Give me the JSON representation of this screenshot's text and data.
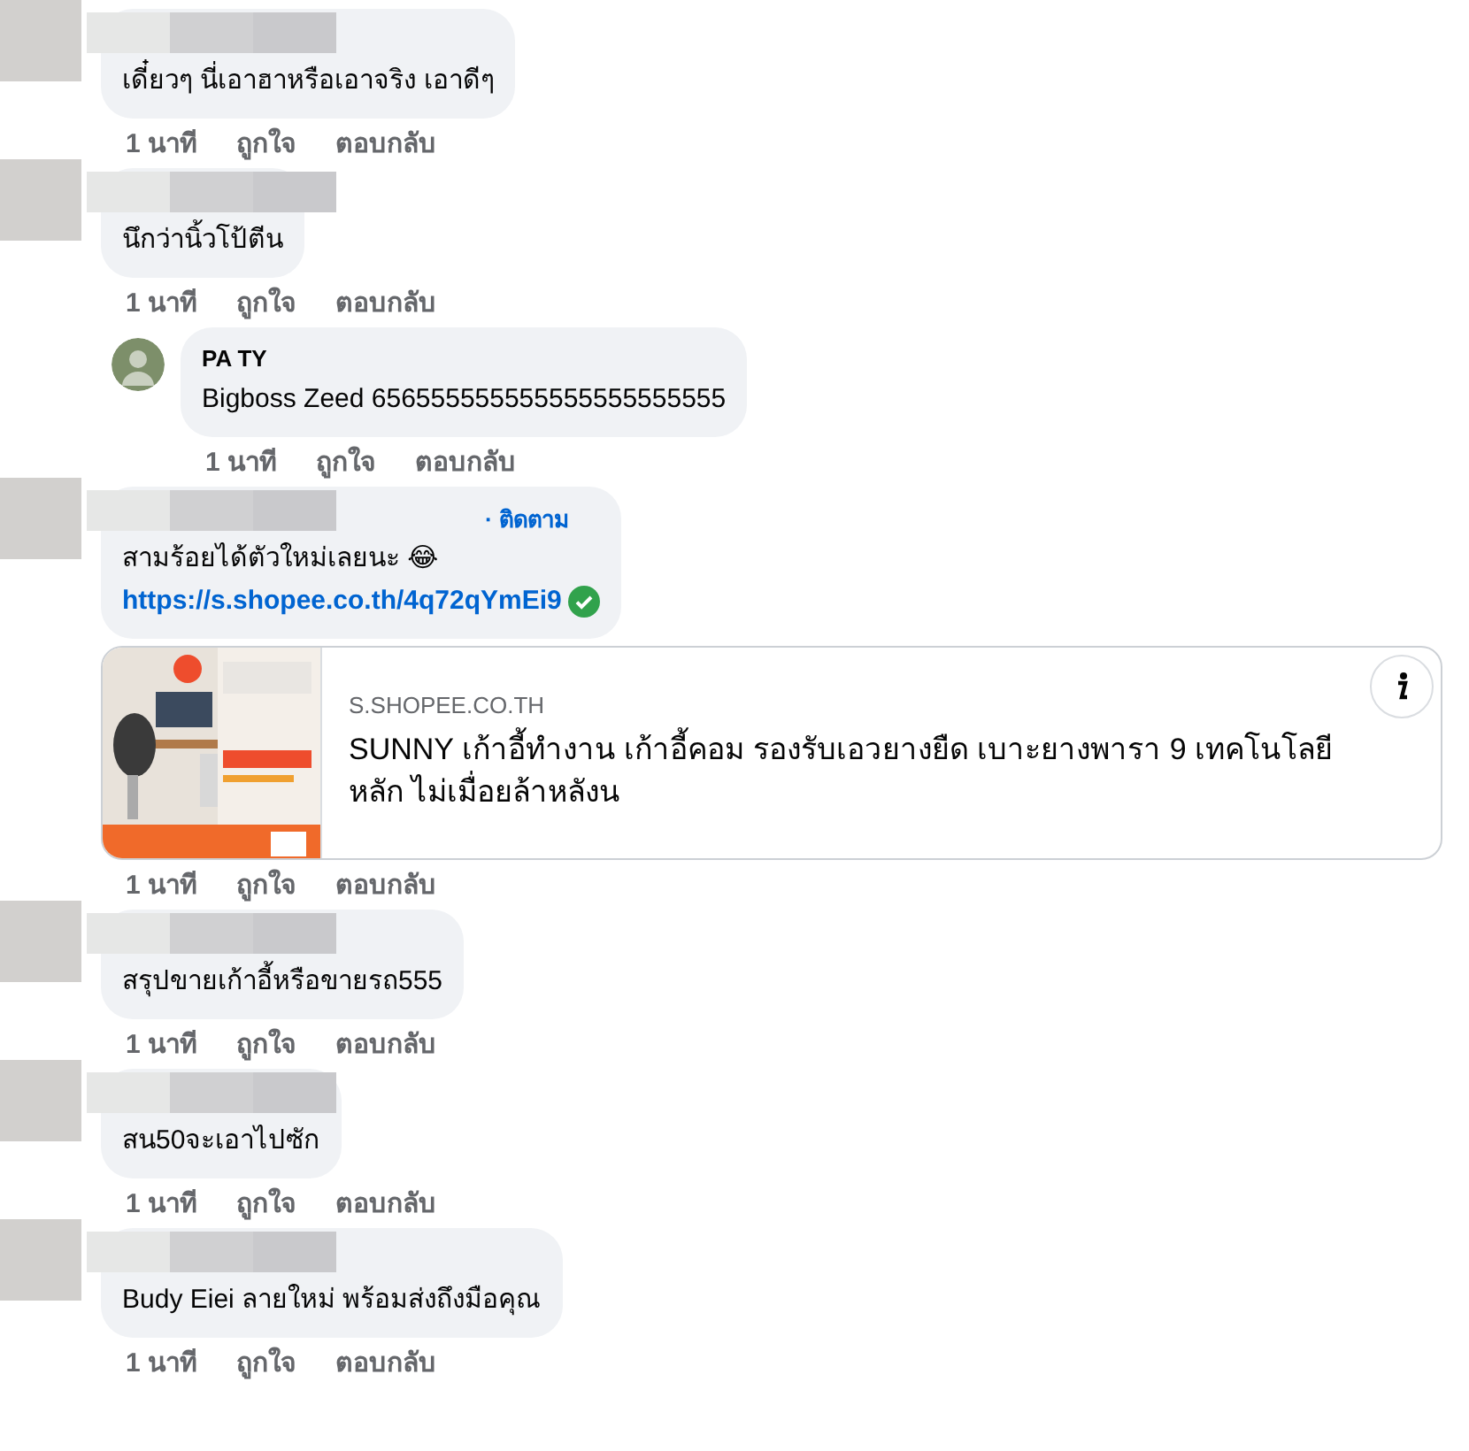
{
  "comments": [
    {
      "author_redacted": true,
      "text": "เดี๋ยวๆ นี่เอาฮาหรือเอาจริง เอาดีๆ",
      "actions": [
        "1 นาที",
        "ถูกใจ",
        "ตอบกลับ"
      ]
    },
    {
      "author_redacted": true,
      "text": "นึกว่านิ้วโป้ตีน",
      "actions": [
        "1 นาที",
        "ถูกใจ",
        "ตอบกลับ"
      ],
      "replies": [
        {
          "author": "PA TY",
          "text": "Bigboss Zeed 656555555555555555555555",
          "actions": [
            "1 นาที",
            "ถูกใจ",
            "ตอบกลับ"
          ]
        }
      ]
    },
    {
      "author_redacted": true,
      "follow": "· ติดตาม",
      "text": "สามร้อยได้ตัวใหม่เลยนะ 😂",
      "link": "https://s.shopee.co.th/4q72qYmEi9",
      "link_verified": true,
      "preview": {
        "domain": "S.SHOPEE.CO.TH",
        "title": "SUNNY เก้าอี้ทำงาน เก้าอี้คอม รองรับเอวยางยืด เบาะยางพารา 9 เทคโนโลยีหลัก ไม่เมื่อยล้าหลังน"
      },
      "actions": [
        "1 นาที",
        "ถูกใจ",
        "ตอบกลับ"
      ]
    },
    {
      "author_redacted": true,
      "text": "สรุปขายเก้าอี้หรือขายรถ555",
      "actions": [
        "1 นาที",
        "ถูกใจ",
        "ตอบกลับ"
      ]
    },
    {
      "author_redacted": true,
      "text": "สน50จะเอาไปซัก",
      "actions": [
        "1 นาที",
        "ถูกใจ",
        "ตอบกลับ"
      ]
    },
    {
      "author_redacted": true,
      "text": "Budy Eiei ลายใหม่ พร้อมส่งถึงมือคุณ",
      "actions": [
        "1 นาที",
        "ถูกใจ",
        "ตอบกลับ"
      ]
    }
  ]
}
